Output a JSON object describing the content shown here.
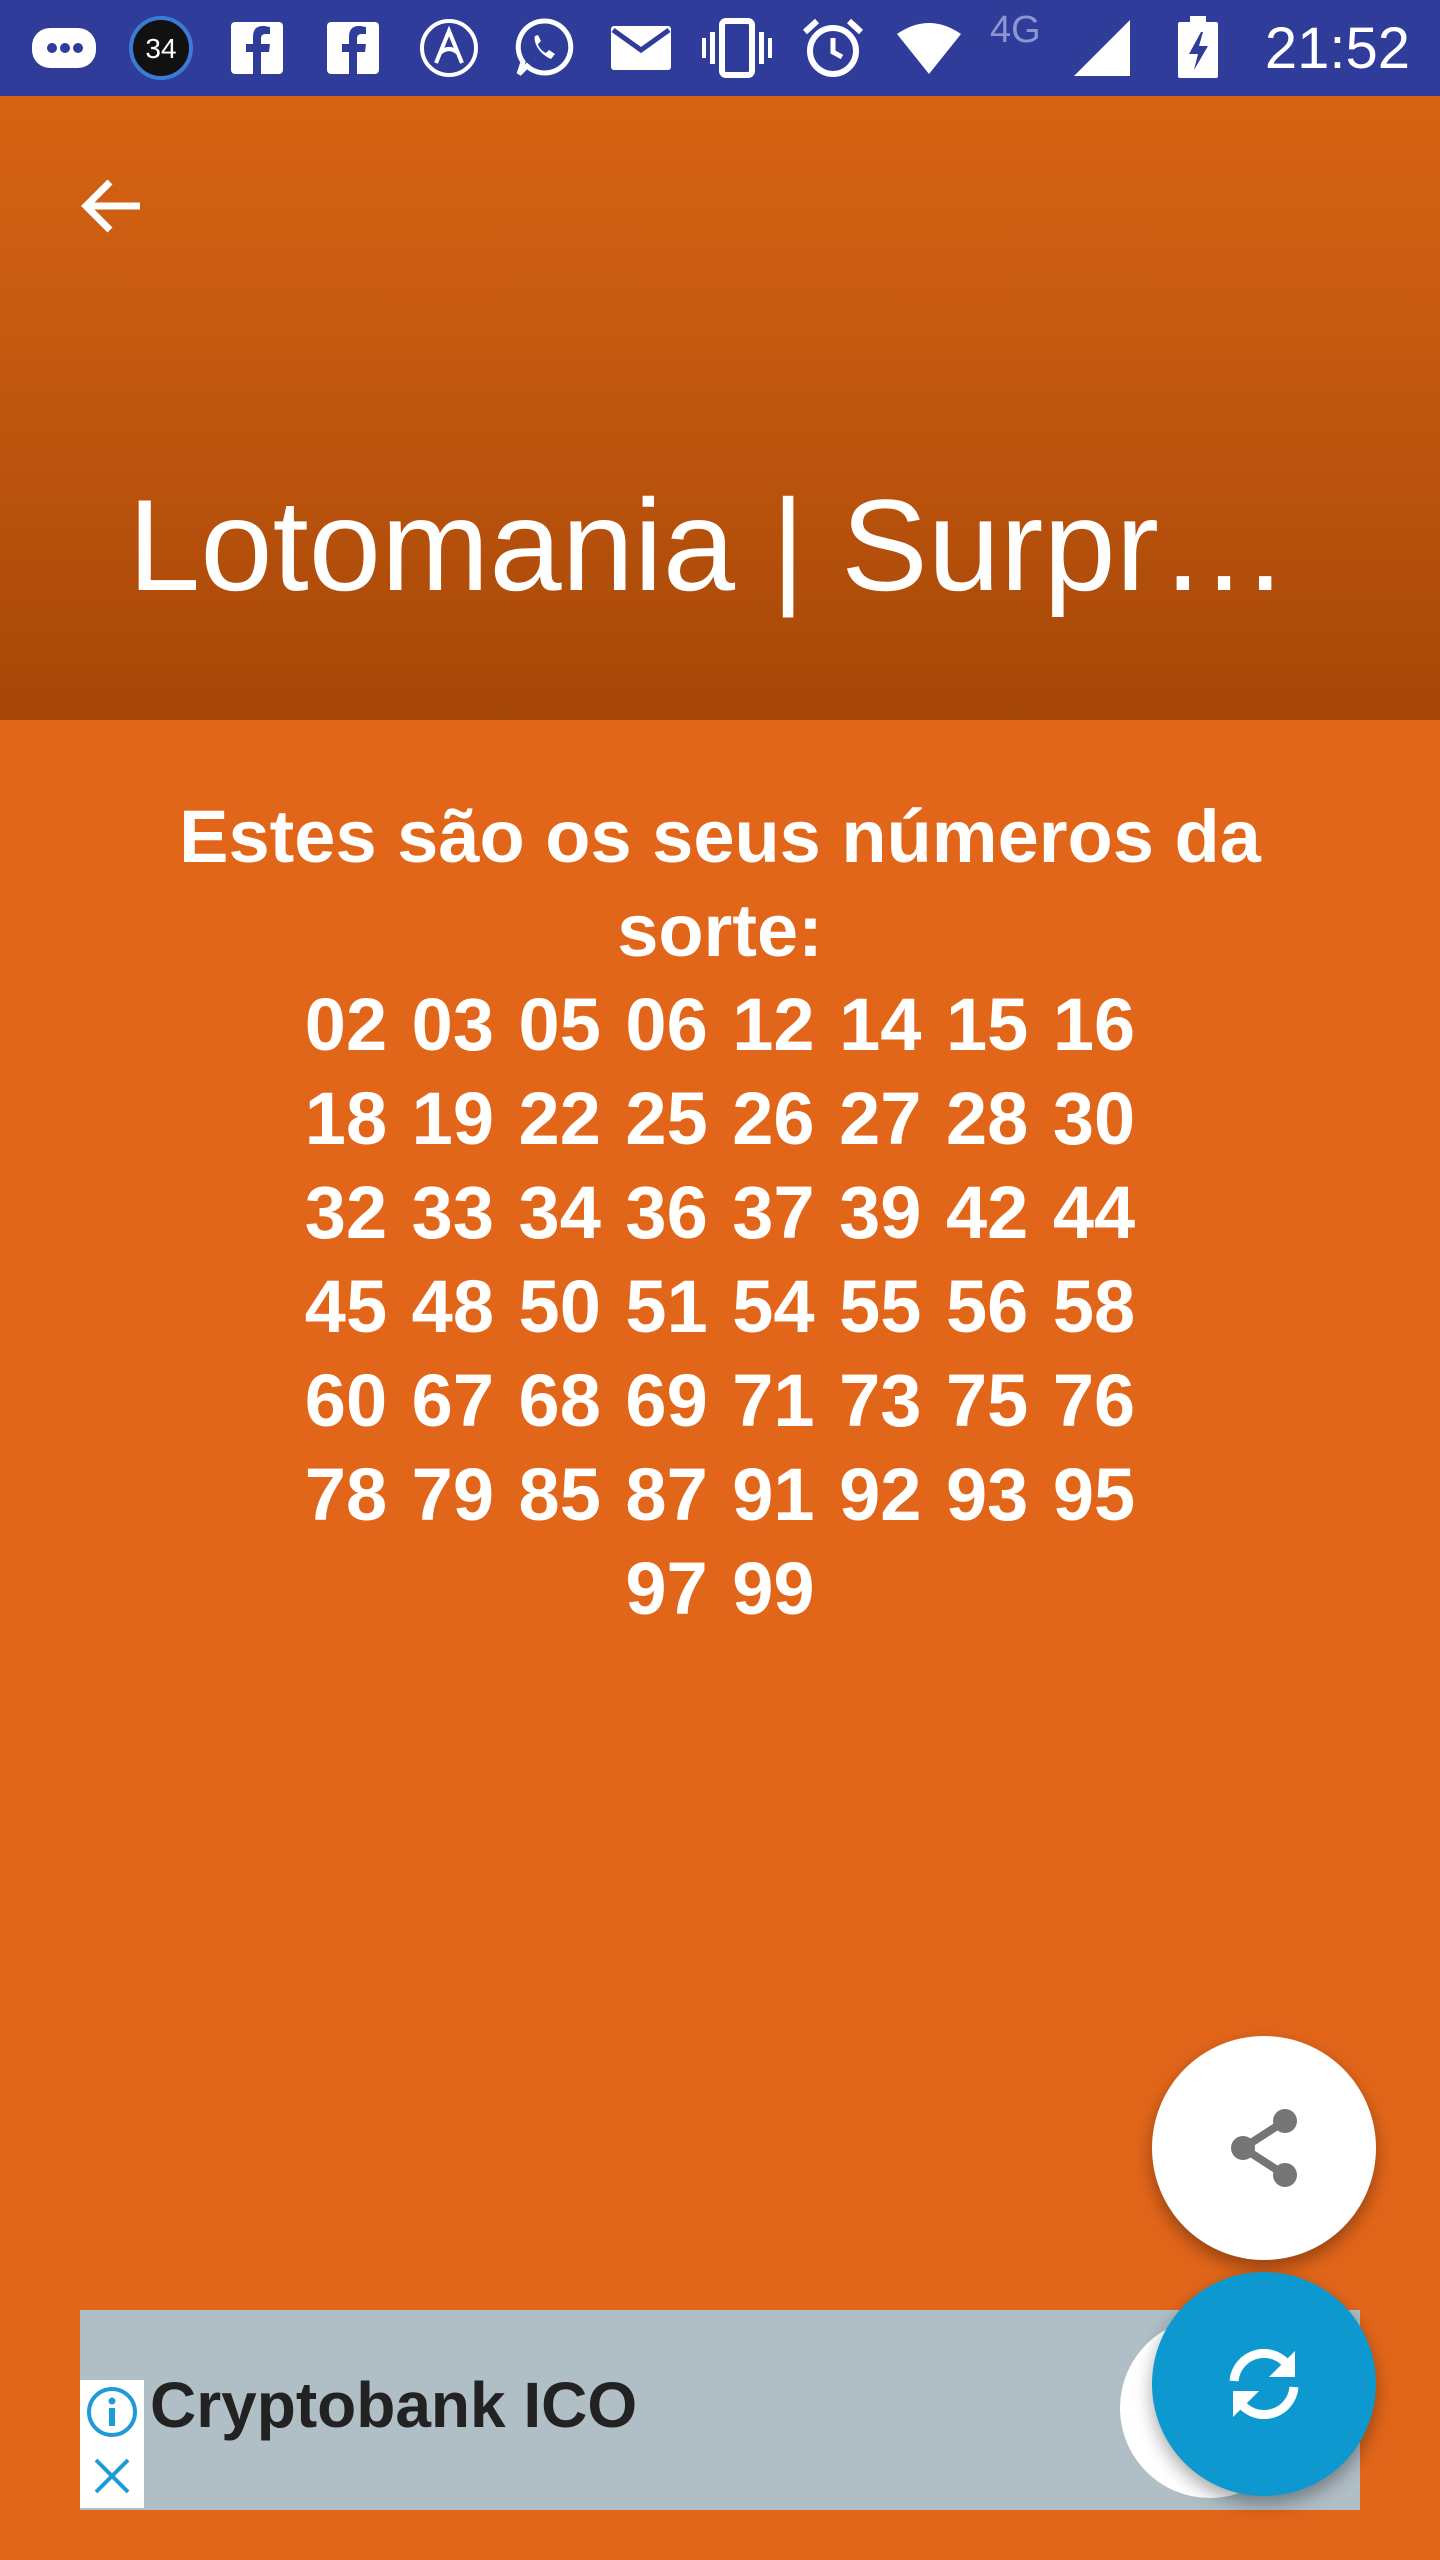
{
  "status_bar": {
    "notification_count": "34",
    "network_label": "4G",
    "time": "21:52",
    "icons": [
      "message-icon",
      "badge-icon",
      "facebook-icon",
      "facebook-icon",
      "arrow-app-icon",
      "whatsapp-icon",
      "email-icon",
      "vibrate-icon",
      "alarm-icon",
      "wifi-icon",
      "signal-icon",
      "battery-icon"
    ]
  },
  "appbar": {
    "title": "Lotomania | Surpr…",
    "back_icon": "back-arrow-icon"
  },
  "content": {
    "heading": "Estes são os seus números da sorte:",
    "numbers": "02 03 05 06 12 14 15 16 18 19 22 25 26 27 28 30 32 33 34 36 37 39 42 44 45 48 50 51 54 55 56 58 60 67 68 69 71 73 75 76 78 79 85 87 91 92 93 95 97 99"
  },
  "fabs": {
    "share_icon": "share-icon",
    "refresh_icon": "refresh-icon"
  },
  "ad": {
    "text": "Cryptobank ICO",
    "info_icon": "info-icon",
    "close_icon": "close-icon"
  },
  "colors": {
    "status_bar": "#2F3C9A",
    "background": "#E2661A",
    "appbar_top": "#D76313",
    "appbar_bottom": "#A64707",
    "fab_refresh": "#0D98D0",
    "ad_background": "#B0BEC5"
  }
}
